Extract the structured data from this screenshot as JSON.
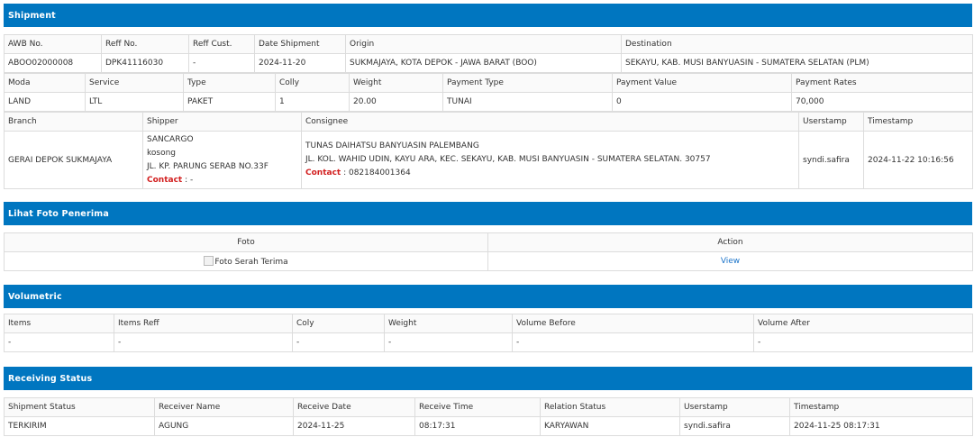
{
  "shipment": {
    "title": "Shipment",
    "row1_headers": [
      "AWB No.",
      "Reff No.",
      "Reff Cust.",
      "Date Shipment",
      "Origin",
      "Destination"
    ],
    "row1_values": [
      "ABOO02000008",
      "DPK41116030",
      "-",
      "2024-11-20",
      "SUKMAJAYA, KOTA DEPOK - JAWA BARAT (BOO)",
      "SEKAYU, KAB. MUSI BANYUASIN - SUMATERA SELATAN (PLM)"
    ],
    "row2_headers": [
      "Moda",
      "Service",
      "Type",
      "Colly",
      "Weight",
      "Payment Type",
      "Payment Value",
      "Payment Rates"
    ],
    "row2_values": [
      "LAND",
      "LTL",
      "PAKET",
      "1",
      "20.00",
      "TUNAI",
      "0",
      "70,000"
    ],
    "row3_headers": [
      "Branch",
      "Shipper",
      "Consignee",
      "Userstamp",
      "Timestamp"
    ],
    "branch": "GERAI DEPOK SUKMAJAYA",
    "shipper": {
      "name": "SANCARGO",
      "line2": "kosong",
      "address": "JL. KP. PARUNG SERAB NO.33F",
      "contact_label": "Contact",
      "contact_value": " : -"
    },
    "consignee": {
      "name": "TUNAS DAIHATSU BANYUASIN PALEMBANG",
      "address": "JL. KOL. WAHID UDIN, KAYU ARA, KEC. SEKAYU, KAB. MUSI BANYUASIN - SUMATERA SELATAN. 30757",
      "contact_label": "Contact",
      "contact_value": " : 082184001364"
    },
    "userstamp": "syndi.safira",
    "timestamp": "2024-11-22 10:16:56"
  },
  "photo": {
    "title": "Lihat Foto Penerima",
    "headers": [
      "Foto",
      "Action"
    ],
    "image_alt": "Foto Serah Terima",
    "action_label": "View"
  },
  "volumetric": {
    "title": "Volumetric",
    "headers": [
      "Items",
      "Items Reff",
      "Coly",
      "Weight",
      "Volume Before",
      "Volume After"
    ],
    "values": [
      "-",
      "-",
      "-",
      "-",
      "-",
      "-"
    ]
  },
  "receiving": {
    "title": "Receiving Status",
    "headers": [
      "Shipment Status",
      "Receiver Name",
      "Receive Date",
      "Receive Time",
      "Relation Status",
      "Userstamp",
      "Timestamp"
    ],
    "values": [
      "TERKIRIM",
      "AGUNG",
      "2024-11-25",
      "08:17:31",
      "KARYAWAN",
      "syndi.safira",
      "2024-11-25 08:17:31"
    ]
  }
}
